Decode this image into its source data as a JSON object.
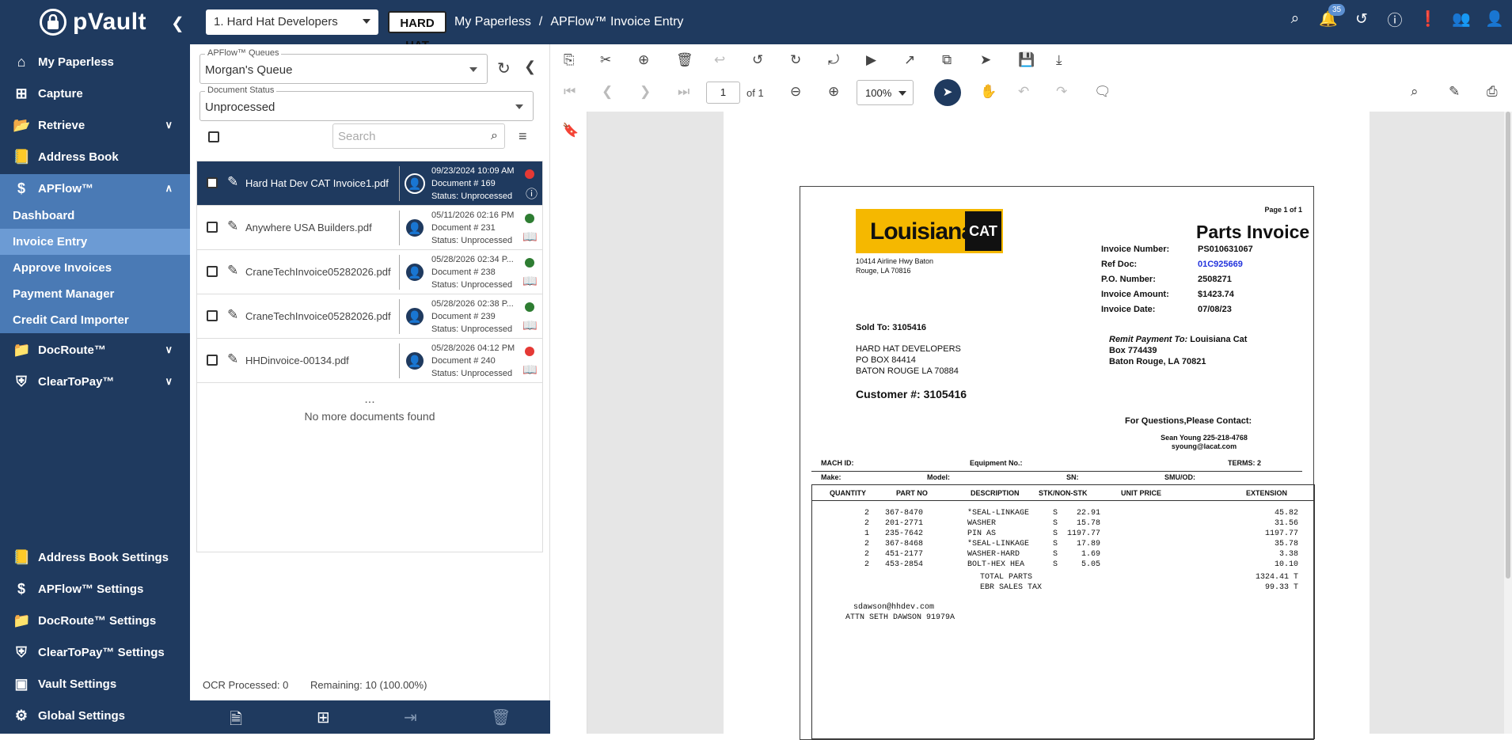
{
  "app": {
    "brand": "pVault",
    "company": "1. Hard Hat Developers",
    "company_logo": "HARD HAT",
    "breadcrumb": [
      "My Paperless",
      "/",
      "APFlow™ Invoice Entry"
    ],
    "notif_count": "35"
  },
  "sidebar": {
    "items": [
      {
        "label": "My Paperless"
      },
      {
        "label": "Capture"
      },
      {
        "label": "Retrieve"
      },
      {
        "label": "Address Book"
      },
      {
        "label": "APFlow™"
      },
      {
        "label": "DocRoute™"
      },
      {
        "label": "ClearToPay™"
      }
    ],
    "sub": [
      "Dashboard",
      "Invoice Entry",
      "Approve Invoices",
      "Payment Manager",
      "Credit Card Importer"
    ],
    "settings": [
      "Address Book Settings",
      "APFlow™ Settings",
      "DocRoute™ Settings",
      "ClearToPay™ Settings",
      "Vault Settings",
      "Global Settings"
    ]
  },
  "queue": {
    "label": "APFlow™ Queues",
    "value": "Morgan's Queue"
  },
  "status": {
    "label": "Document Status",
    "value": "Unprocessed"
  },
  "search": {
    "placeholder": "Search"
  },
  "docs": [
    {
      "name": "Hard Hat Dev CAT Invoice1.pdf",
      "date": "09/23/2024 10:09 AM",
      "doc": "Document # 169",
      "status": "Status: Unprocessed"
    },
    {
      "name": "Anywhere USA Builders.pdf",
      "date": "05/11/2026 02:16 PM",
      "doc": "Document # 231",
      "status": "Status: Unprocessed"
    },
    {
      "name": "CraneTechInvoice05282026.pdf",
      "date": "05/28/2026 02:34 P...",
      "doc": "Document # 238",
      "status": "Status: Unprocessed"
    },
    {
      "name": "CraneTechInvoice05282026.pdf",
      "date": "05/28/2026 02:38 P...",
      "doc": "Document # 239",
      "status": "Status: Unprocessed"
    },
    {
      "name": "HHDinvoice-00134.pdf",
      "date": "05/28/2026 04:12 PM",
      "doc": "Document # 240",
      "status": "Status: Unprocessed"
    }
  ],
  "list_footer": {
    "ellipsis": "...",
    "nomore": "No more documents found"
  },
  "ocr": {
    "processed": "OCR Processed: 0",
    "remaining": "Remaining: 10 (100.00%)"
  },
  "viewer": {
    "page": "1",
    "of": "of 1",
    "zoom": "100%"
  },
  "colors": {
    "nav": "#1f3a5f",
    "nav_active": "#4a7ab5",
    "red": "#e53935",
    "green": "#2e7d32",
    "cat_yellow": "#f5b800"
  },
  "invoice": {
    "page": "Page 1 of 1",
    "title": "Parts Invoice",
    "logo": "Louisiana",
    "logo_cat": "CAT",
    "addr1": "10414 Airline Hwy Baton",
    "addr2": "Rouge, LA 70816",
    "fields": [
      {
        "k": "Invoice Number:",
        "v": "PS010631067"
      },
      {
        "k": "Ref Doc:",
        "v": "01C925669"
      },
      {
        "k": "P.O. Number:",
        "v": "2508271"
      },
      {
        "k": "Invoice Amount:",
        "v": "$1423.74"
      },
      {
        "k": "Invoice Date:",
        "v": "07/08/23"
      }
    ],
    "sold_to": "Sold To:  3105416",
    "sold1": "HARD HAT DEVELOPERS",
    "sold2": "PO BOX 84414",
    "sold3": "BATON ROUGE LA 70884",
    "remit_label": "Remit Payment To:",
    "remit1": "Louisiana Cat",
    "remit2": "Box 774439",
    "remit3": "Baton Rouge, LA 70821",
    "customer": "Customer #:  3105416",
    "questions": "For Questions,Please Contact:",
    "contact1": "Sean Young 225-218-4768",
    "contact2": "syoung@lacat.com",
    "mach": "MACH ID:",
    "equip": "Equipment No.:",
    "terms": "TERMS:   2",
    "make": "Make:",
    "model": "Model:",
    "sn": "SN:",
    "smu": "SMU/OD:",
    "headers": [
      "QUANTITY",
      "PART NO",
      "DESCRIPTION",
      "STK/NON-STK",
      "UNIT PRICE",
      "EXTENSION"
    ],
    "rows": [
      [
        "2",
        "367-8470",
        "*SEAL-LINKAGE",
        "S",
        "22.91",
        "45.82"
      ],
      [
        "2",
        "201-2771",
        "WASHER",
        "S",
        "15.78",
        "31.56"
      ],
      [
        "1",
        "235-7642",
        "PIN AS",
        "S",
        "1197.77",
        "1197.77"
      ],
      [
        "2",
        "367-8468",
        "*SEAL-LINKAGE",
        "S",
        "17.89",
        "35.78"
      ],
      [
        "2",
        "451-2177",
        "WASHER-HARD",
        "S",
        "1.69",
        "3.38"
      ],
      [
        "2",
        "453-2854",
        "BOLT-HEX HEA",
        "S",
        "5.05",
        "10.10"
      ]
    ],
    "total_parts": "TOTAL PARTS",
    "total_parts_val": "1324.41 T",
    "tax": "EBR SALES TAX",
    "tax_val": "99.33 T",
    "email": "sdawson@hhdev.com",
    "attn": "ATTN SETH DAWSON 91979A"
  }
}
